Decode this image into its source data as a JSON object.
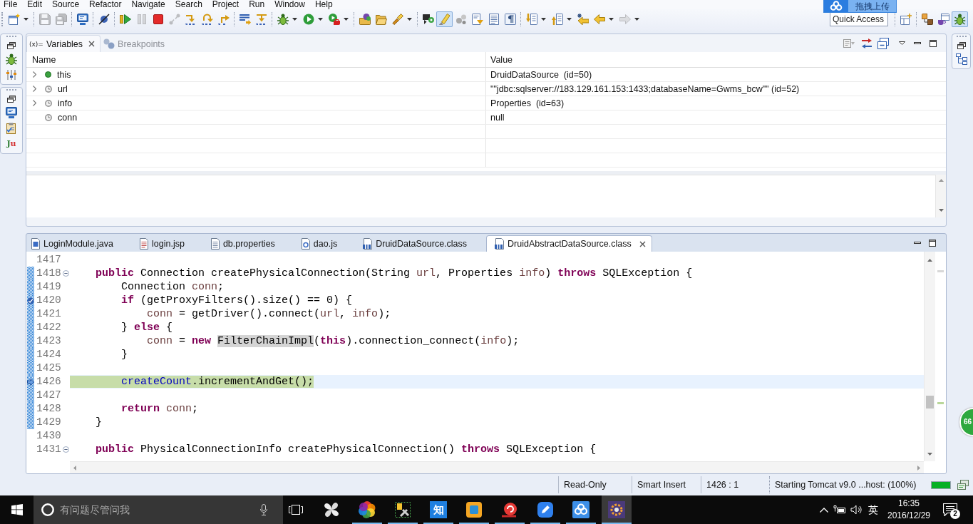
{
  "menu_bar": [
    "File",
    "Edit",
    "Source",
    "Refactor",
    "Navigate",
    "Search",
    "Project",
    "Run",
    "Window",
    "Help"
  ],
  "upload_widget": {
    "label": "拖拽上传"
  },
  "toolbar": {
    "groups": [
      [
        {
          "disabled": false,
          "pressed": false,
          "dropdown": true
        }
      ],
      [
        {
          "disabled": true,
          "pressed": false,
          "dropdown": false
        },
        {
          "disabled": true,
          "pressed": false,
          "dropdown": false
        }
      ],
      [
        {
          "disabled": false,
          "pressed": false,
          "dropdown": false
        }
      ],
      [
        {
          "disabled": false,
          "pressed": false,
          "dropdown": false
        }
      ],
      [
        {
          "disabled": false,
          "pressed": false,
          "dropdown": false
        },
        {
          "disabled": true,
          "pressed": false,
          "dropdown": false
        },
        {
          "disabled": false,
          "pressed": false,
          "dropdown": false
        },
        {
          "disabled": true,
          "pressed": false,
          "dropdown": false
        },
        {
          "disabled": false,
          "pressed": false,
          "dropdown": false
        },
        {
          "disabled": false,
          "pressed": false,
          "dropdown": false
        },
        {
          "disabled": false,
          "pressed": false,
          "dropdown": false
        }
      ],
      [
        {
          "disabled": false,
          "pressed": false,
          "dropdown": false
        },
        {
          "disabled": false,
          "pressed": false,
          "dropdown": false
        }
      ],
      [
        {
          "disabled": false,
          "pressed": false,
          "dropdown": true
        },
        {
          "disabled": false,
          "pressed": false,
          "dropdown": true
        },
        {
          "disabled": false,
          "pressed": false,
          "dropdown": true
        }
      ],
      [
        {
          "disabled": false,
          "pressed": false,
          "dropdown": false
        },
        {
          "disabled": false,
          "pressed": false,
          "dropdown": false
        },
        {
          "disabled": false,
          "pressed": false,
          "dropdown": true
        }
      ],
      [
        {
          "disabled": false,
          "pressed": false,
          "dropdown": false
        },
        {
          "disabled": false,
          "pressed": true,
          "dropdown": false
        },
        {
          "disabled": false,
          "pressed": false,
          "dropdown": false
        },
        {
          "disabled": false,
          "pressed": false,
          "dropdown": false
        },
        {
          "disabled": false,
          "pressed": false,
          "dropdown": false
        },
        {
          "disabled": false,
          "pressed": false,
          "dropdown": false
        }
      ],
      [
        {
          "disabled": false,
          "pressed": false,
          "dropdown": true
        },
        {
          "disabled": false,
          "pressed": false,
          "dropdown": true
        },
        {
          "disabled": false,
          "pressed": false,
          "dropdown": false
        },
        {
          "disabled": false,
          "pressed": false,
          "dropdown": true
        },
        {
          "disabled": true,
          "pressed": false,
          "dropdown": true
        }
      ]
    ],
    "quick_access": {
      "placeholder": "Quick Access"
    },
    "perspectives": [
      {
        "selected": false
      },
      {
        "selected": false
      },
      {
        "selected": true
      }
    ]
  },
  "left_trim": {
    "junit_icon_text": "Ju"
  },
  "variables_view": {
    "tabs": [
      {
        "kind": "variables",
        "glyph": "(x)=",
        "label": "Variables",
        "selected": true
      },
      {
        "kind": "breakpoints",
        "label": "Breakpoints",
        "selected": false
      }
    ],
    "columns": [
      "Name",
      "Value"
    ],
    "rows": [
      {
        "kind": "this",
        "name": "this",
        "value": "DruidDataSource  (id=50)",
        "expandable": true,
        "expanded": false
      },
      {
        "kind": "local",
        "name": "url",
        "value": "\"\"jdbc:sqlserver://183.129.161.153:1433;databaseName=Gwms_bcw\"\" (id=52)",
        "expandable": true,
        "expanded": false
      },
      {
        "kind": "local",
        "name": "info",
        "value": "Properties  (id=63)",
        "expandable": true,
        "expanded": false
      },
      {
        "kind": "local",
        "name": "conn",
        "value": "null",
        "expandable": false,
        "expanded": false
      }
    ]
  },
  "editor": {
    "tabs": [
      {
        "kind": "java",
        "label": "LoginModule.java",
        "selected": false
      },
      {
        "kind": "jsp",
        "label": "login.jsp",
        "selected": false
      },
      {
        "kind": "properties",
        "label": "db.properties",
        "selected": false
      },
      {
        "kind": "js",
        "label": "dao.js",
        "selected": false
      },
      {
        "kind": "class",
        "label": "DruidDataSource.class",
        "selected": false
      },
      {
        "kind": "class",
        "label": "DruidAbstractDataSource.class",
        "selected": true
      }
    ],
    "lines": [
      {
        "number": "1417",
        "in_range": false,
        "current": false,
        "breakpoint": false,
        "foldable": false
      },
      {
        "number": "1418",
        "tokens": [
          {
            "text": "    public",
            "kind": "keyword"
          },
          {
            "text": " Connection createPhysicalConnection(String ",
            "kind": "plain"
          },
          {
            "text": "url",
            "kind": "local"
          },
          {
            "text": ", Properties ",
            "kind": "plain"
          },
          {
            "text": "info",
            "kind": "local"
          },
          {
            "text": ") ",
            "kind": "plain"
          },
          {
            "text": "throws",
            "kind": "keyword"
          },
          {
            "text": " SQLException {",
            "kind": "plain"
          }
        ],
        "in_range": true,
        "current": false,
        "breakpoint": false,
        "foldable": true
      },
      {
        "number": "1419",
        "tokens": [
          {
            "text": "        Connection ",
            "kind": "plain"
          },
          {
            "text": "conn",
            "kind": "local"
          },
          {
            "text": ";",
            "kind": "plain"
          }
        ],
        "in_range": true,
        "current": false,
        "breakpoint": false,
        "foldable": false
      },
      {
        "number": "1420",
        "tokens": [
          {
            "text": "        if",
            "kind": "keyword"
          },
          {
            "text": " (getProxyFilters().size() == 0) {",
            "kind": "plain"
          }
        ],
        "in_range": true,
        "current": false,
        "breakpoint": true,
        "foldable": false
      },
      {
        "number": "1421",
        "tokens": [
          {
            "text": "            conn",
            "kind": "local"
          },
          {
            "text": " = getDriver().connect(",
            "kind": "plain"
          },
          {
            "text": "url",
            "kind": "local"
          },
          {
            "text": ", ",
            "kind": "plain"
          },
          {
            "text": "info",
            "kind": "local"
          },
          {
            "text": ");",
            "kind": "plain"
          }
        ],
        "in_range": true,
        "current": false,
        "breakpoint": false,
        "foldable": false
      },
      {
        "number": "1422",
        "tokens": [
          {
            "text": "        } ",
            "kind": "plain"
          },
          {
            "text": "else",
            "kind": "keyword"
          },
          {
            "text": " {",
            "kind": "plain"
          }
        ],
        "in_range": true,
        "current": false,
        "breakpoint": false,
        "foldable": false
      },
      {
        "number": "1423",
        "tokens": [
          {
            "text": "            conn",
            "kind": "local"
          },
          {
            "text": " = ",
            "kind": "plain"
          },
          {
            "text": "new ",
            "kind": "keyword"
          },
          {
            "text": "FilterChainImpl",
            "kind": "occurrence"
          },
          {
            "text": "(",
            "kind": "plain"
          },
          {
            "text": "this",
            "kind": "keyword"
          },
          {
            "text": ").connection_connect(",
            "kind": "plain"
          },
          {
            "text": "info",
            "kind": "local"
          },
          {
            "text": ");",
            "kind": "plain"
          }
        ],
        "in_range": true,
        "current": false,
        "breakpoint": false,
        "foldable": false
      },
      {
        "number": "1424",
        "tokens": [
          {
            "text": "        }",
            "kind": "plain"
          }
        ],
        "in_range": true,
        "current": false,
        "breakpoint": false,
        "foldable": false
      },
      {
        "number": "1425",
        "in_range": true,
        "current": false,
        "breakpoint": false,
        "foldable": false
      },
      {
        "number": "1426",
        "tokens": [
          {
            "text": "        createCount",
            "kind": "field"
          },
          {
            "text": ".incrementAndGet();",
            "kind": "plain"
          }
        ],
        "in_range": true,
        "current": true,
        "breakpoint": false,
        "foldable": false
      },
      {
        "number": "1427",
        "in_range": true,
        "current": false,
        "breakpoint": false,
        "foldable": false
      },
      {
        "number": "1428",
        "tokens": [
          {
            "text": "        return ",
            "kind": "keyword"
          },
          {
            "text": "conn",
            "kind": "local"
          },
          {
            "text": ";",
            "kind": "plain"
          }
        ],
        "in_range": true,
        "current": false,
        "breakpoint": false,
        "foldable": false
      },
      {
        "number": "1429",
        "tokens": [
          {
            "text": "    }",
            "kind": "plain"
          }
        ],
        "in_range": true,
        "current": false,
        "breakpoint": false,
        "foldable": false
      },
      {
        "number": "1430",
        "in_range": false,
        "current": false,
        "breakpoint": false,
        "foldable": false
      },
      {
        "number": "1431",
        "tokens": [
          {
            "text": "    public",
            "kind": "keyword"
          },
          {
            "text": " PhysicalConnectionInfo createPhysicalConnection() ",
            "kind": "plain"
          },
          {
            "text": "throws",
            "kind": "keyword"
          },
          {
            "text": " SQLException {",
            "kind": "plain"
          }
        ],
        "in_range": false,
        "current": false,
        "breakpoint": false,
        "foldable": true
      }
    ]
  },
  "status_bar": {
    "fields": [
      "Read-Only",
      "Smart Insert",
      "1426 : 1"
    ],
    "progress": {
      "label": "Starting Tomcat v9.0 ...host: (100%)",
      "level": 1
    }
  },
  "taskbar": {
    "search": {
      "placeholder": "有问题尽管问我"
    },
    "apps": [
      {
        "running": false,
        "active": false
      },
      {
        "running": true,
        "active": false
      },
      {
        "running": true,
        "active": false
      },
      {
        "running": true,
        "active": false,
        "glyph": "知"
      },
      {
        "running": true,
        "active": false
      },
      {
        "running": true,
        "active": false
      },
      {
        "running": true,
        "active": false
      },
      {
        "running": true,
        "active": false
      },
      {
        "running": true,
        "active": true
      }
    ],
    "tray": {
      "input_method": "英",
      "time": "16:35",
      "date": "2016/12/29",
      "notification_count": "2"
    }
  },
  "floating_ball": {
    "label": "66"
  }
}
